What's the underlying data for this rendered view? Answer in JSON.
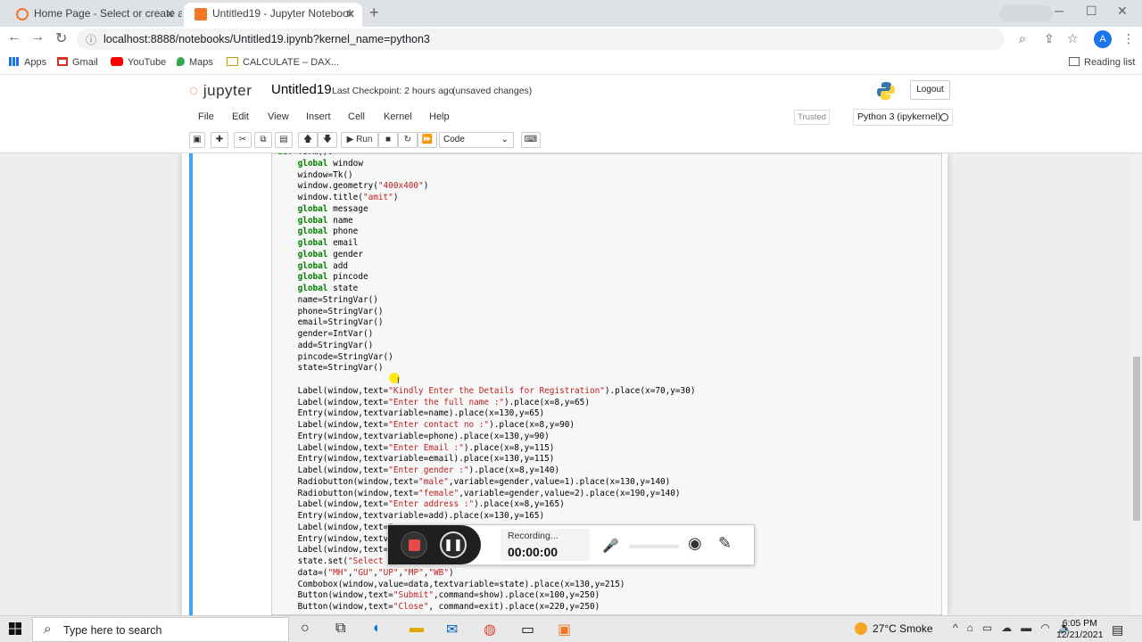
{
  "browser": {
    "tabs": [
      {
        "title": "Home Page - Select or create a",
        "active": false
      },
      {
        "title": "Untitled19 - Jupyter Notebook",
        "active": true
      }
    ],
    "url": "localhost:8888/notebooks/Untitled19.ipynb?kernel_name=python3",
    "avatar_letter": "A",
    "bookmarks": [
      "Apps",
      "Gmail",
      "YouTube",
      "Maps",
      "CALCULATE – DAX..."
    ],
    "reading_list": "Reading list"
  },
  "jupyter": {
    "logo": "jupyter",
    "notebook_name": "Untitled19",
    "checkpoint": "Last Checkpoint: 2 hours ago",
    "unsaved": "(unsaved changes)",
    "logout": "Logout",
    "menu": [
      "File",
      "Edit",
      "View",
      "Insert",
      "Cell",
      "Kernel",
      "Help"
    ],
    "trusted": "Trusted",
    "kernel": "Python 3 (ipykernel)",
    "run_label": "Run",
    "cell_type": "Code"
  },
  "code_lines": [
    "def form():",
    "    global window",
    "    window=Tk()",
    "    window.geometry(\"400x400\")",
    "    window.title(\"amit\")",
    "    global message",
    "    global name",
    "    global phone",
    "    global email",
    "    global gender",
    "    global add",
    "    global pincode",
    "    global state",
    "    name=StringVar()",
    "    phone=StringVar()",
    "    email=StringVar()",
    "    gender=IntVar()",
    "    add=StringVar()",
    "    pincode=StringVar()",
    "    state=StringVar()",
    "",
    "    Label(window,text=\"Kindly Enter the Details for Registration\").place(x=70,y=30)",
    "    Label(window,text=\"Enter the full name :\").place(x=8,y=65)",
    "    Entry(window,textvariable=name).place(x=130,y=65)",
    "    Label(window,text=\"Enter contact no :\").place(x=8,y=90)",
    "    Entry(window,textvariable=phone).place(x=130,y=90)",
    "    Label(window,text=\"Enter Email :\").place(x=8,y=115)",
    "    Entry(window,textvariable=email).place(x=130,y=115)",
    "    Label(window,text=\"Enter gender :\").place(x=8,y=140)",
    "    Radiobutton(window,text=\"male\",variable=gender,value=1).place(x=130,y=140)",
    "    Radiobutton(window,text=\"female\",variable=gender,value=2).place(x=190,y=140)",
    "    Label(window,text=\"Enter address :\").place(x=8,y=165)",
    "    Entry(window,textvariable=add).place(x=130,y=165)",
    "    Label(window,text=\"",
    "    Entry(window,textvar",
    "    Label(window,text=\"",
    "    state.set(\"Select State\")",
    "    data=(\"MH\",\"GU\",\"UP\",\"MP\",\"WB\")",
    "    Combobox(window,value=data,textvariable=state).place(x=130,y=215)",
    "    Button(window,text=\"Submit\",command=show).place(x=100,y=250)",
    "    Button(window,text=\"Close\", command=exit).place(x=220,y=250)"
  ],
  "recorder": {
    "status": "Recording...",
    "time": "00:00:00"
  },
  "taskbar": {
    "search_placeholder": "Type here to search",
    "weather": "27°C  Smoke",
    "time": "6:05 PM",
    "date": "12/21/2021"
  }
}
